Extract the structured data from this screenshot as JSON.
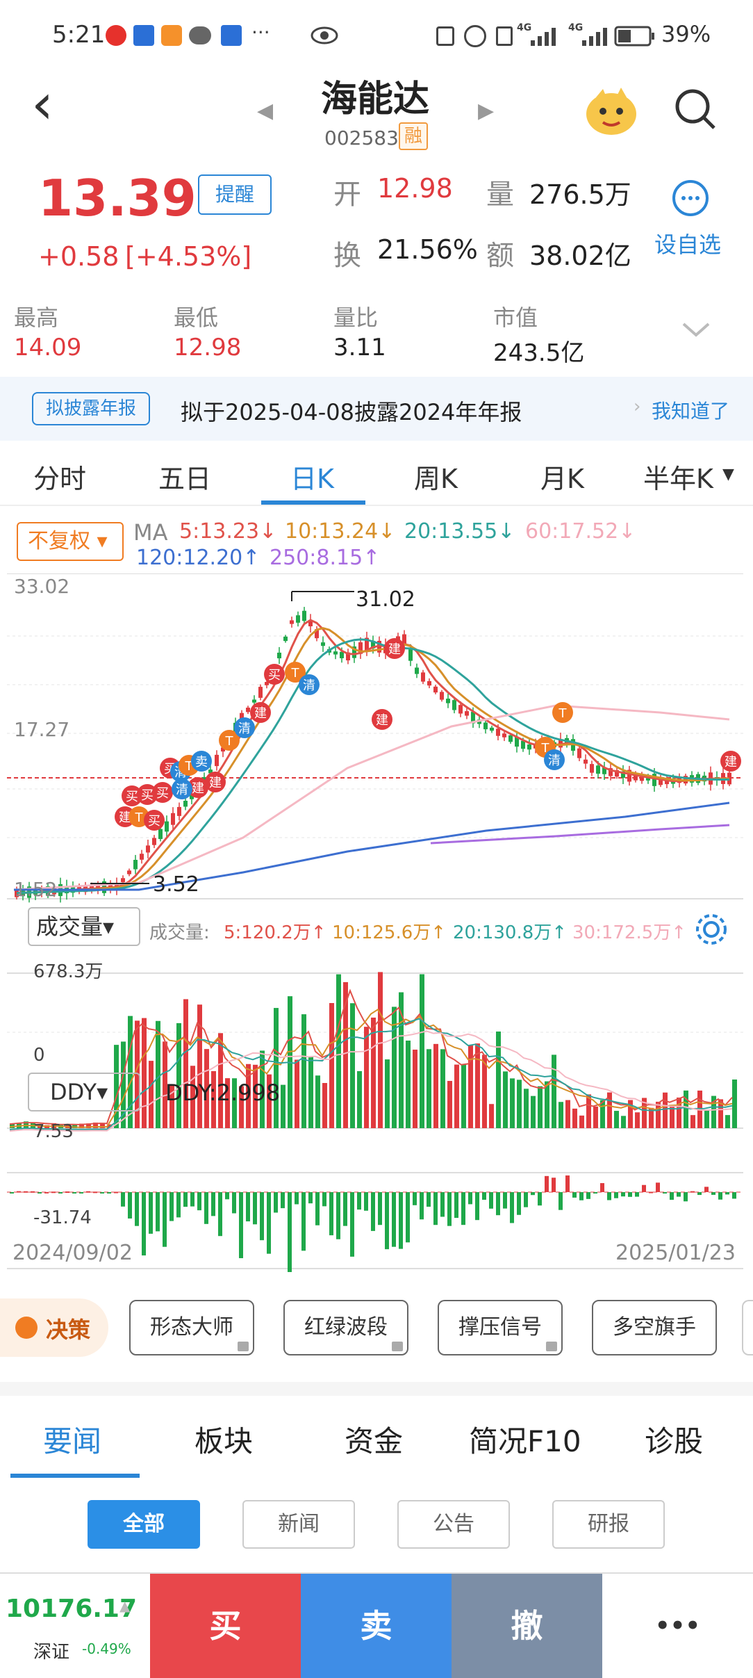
{
  "status_bar": {
    "time": "5:21",
    "dots": "···",
    "battery": "39%",
    "net1": "4G",
    "net2": "4G"
  },
  "header": {
    "back": "‹",
    "title": "海能达",
    "code": "002583",
    "margin_badge": "融",
    "prev": "◀",
    "next": "▶"
  },
  "quote": {
    "price": "13.39",
    "alert_btn": "提醒",
    "change": "+0.58",
    "change_pct": "[+4.53%]",
    "open_label": "开",
    "open": "12.98",
    "vol_label": "量",
    "vol": "276.5万",
    "turnover_label": "换",
    "turnover": "21.56%",
    "amount_label": "额",
    "amount": "38.02亿",
    "add_watch": "设自选"
  },
  "stats": [
    {
      "label": "最高",
      "value": "14.09"
    },
    {
      "label": "最低",
      "value": "12.98"
    },
    {
      "label": "量比",
      "value": "3.11"
    },
    {
      "label": "市值",
      "value": "243.5亿"
    }
  ],
  "notice": {
    "tag": "拟披露年报",
    "text": "拟于2025-04-08披露2024年年报",
    "action": "我知道了"
  },
  "kline_tabs": [
    "分时",
    "五日",
    "日K",
    "周K",
    "月K",
    "半年K"
  ],
  "kline_active": "日K",
  "chart": {
    "adjust": "不复权",
    "ma_label": "MA",
    "ma": [
      {
        "text": "5:13.23↓",
        "color": "#e0524a"
      },
      {
        "text": "10:13.24↓",
        "color": "#d7902a"
      },
      {
        "text": "20:13.55↓",
        "color": "#2fa39c"
      },
      {
        "text": "60:17.52↓",
        "color": "#f2a9b7"
      },
      {
        "text": "120:12.20↑",
        "color": "#3d6fd0"
      },
      {
        "text": "250:8.15↑",
        "color": "#a86ce0"
      }
    ],
    "y_top": "33.02",
    "y_mid": "17.27",
    "y_bottom": "1.52",
    "max_label": "31.02",
    "min_label": "3.52",
    "volume_btn": "成交量",
    "vol_title": "成交量:",
    "vol_ma": [
      {
        "text": "5:120.2万↑",
        "color": "#e0524a"
      },
      {
        "text": "10:125.6万↑",
        "color": "#d7902a"
      },
      {
        "text": "20:130.8万↑",
        "color": "#2fa39c"
      },
      {
        "text": "30:172.5万↑",
        "color": "#f2a9b7"
      }
    ],
    "vol_top": "678.3万",
    "vol_zero": "0",
    "ddy_btn": "DDY",
    "ddy_value": "DDY:2.998",
    "ddy_top": "7.53",
    "ddy_bottom": "-31.74",
    "date_start": "2024/09/02",
    "date_end": "2025/01/23",
    "signals": [
      "建",
      "T",
      "买",
      "买",
      "买",
      "买",
      "建",
      "买",
      "清",
      "建",
      "清",
      "T",
      "卖",
      "T",
      "清",
      "建",
      "买",
      "T",
      "清",
      "建",
      "建",
      "T",
      "清",
      "T",
      "建"
    ]
  },
  "tools": {
    "decision": "决策",
    "items": [
      "形态大师",
      "红绿波段",
      "撑压信号",
      "多空旗手"
    ]
  },
  "news_tabs": [
    "要闻",
    "板块",
    "资金",
    "简况F10",
    "诊股"
  ],
  "news_active": "要闻",
  "filters": [
    "全部",
    "新闻",
    "公告",
    "研报"
  ],
  "filter_active": "全部",
  "bottom": {
    "index_value": "10176.17",
    "index_name": "深证",
    "index_change": "-0.49%",
    "buy": "买",
    "sell": "卖",
    "cancel": "撤",
    "more": "•••"
  }
}
